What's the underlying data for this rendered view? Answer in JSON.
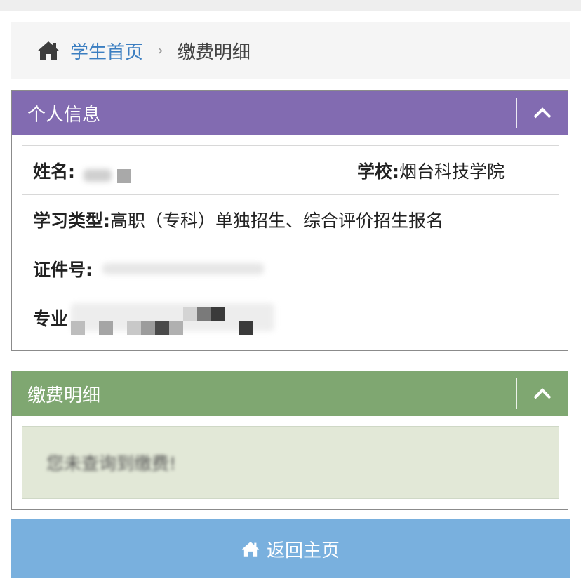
{
  "breadcrumb": {
    "home_label": "学生首页",
    "separator": "›",
    "current": "缴费明细"
  },
  "info_panel": {
    "title": "个人信息",
    "rows": [
      {
        "label": "姓名:",
        "value": ""
      },
      {
        "label": "学校:",
        "value": "烟台科技学院"
      },
      {
        "label": "学习类型:",
        "value": "高职（专科）单独招生、综合评价招生报名"
      },
      {
        "label": "证件号:",
        "value": ""
      },
      {
        "label": "专业",
        "value": ""
      }
    ]
  },
  "fee_panel": {
    "title": "缴费明细",
    "message": "您未查询到缴费!"
  },
  "back_button": {
    "label": "返回主页"
  },
  "icons": {
    "breadcrumb_home": "home-icon",
    "collapse": "chevron-up-icon",
    "back_home": "home-icon"
  },
  "colors": {
    "info_header": "#826bb1",
    "fee_header": "#7fa771",
    "fee_alert_bg": "#e2e8d7",
    "button_bg": "#79b0de",
    "link": "#3b7ec1"
  }
}
